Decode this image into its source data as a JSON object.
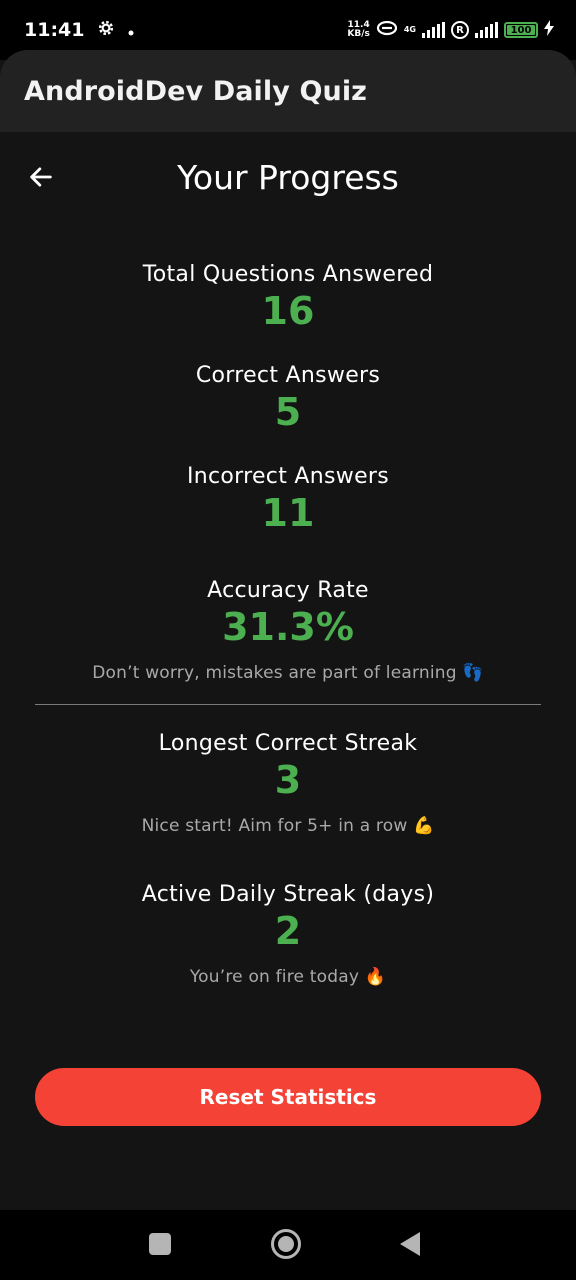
{
  "status_bar": {
    "time": "11:41",
    "speed_value": "11.4",
    "speed_unit": "KB/s",
    "network": "4G",
    "battery": "100"
  },
  "app_bar": {
    "title": "AndroidDev Daily Quiz"
  },
  "header": {
    "title": "Your Progress",
    "back_icon": "arrow-left-icon"
  },
  "stats": {
    "total": {
      "label": "Total Questions Answered",
      "value": "16"
    },
    "correct": {
      "label": "Correct Answers",
      "value": "5"
    },
    "incorrect": {
      "label": "Incorrect Answers",
      "value": "11"
    },
    "accuracy": {
      "label": "Accuracy Rate",
      "value": "31.3%",
      "note": "Don’t worry, mistakes are part of learning 👣"
    },
    "longest_streak": {
      "label": "Longest Correct Streak",
      "value": "3",
      "note": "Nice start! Aim for 5+ in a row 💪"
    },
    "daily_streak": {
      "label": "Active Daily Streak (days)",
      "value": "2",
      "note": "You’re on fire today 🔥"
    }
  },
  "actions": {
    "reset_label": "Reset Statistics"
  },
  "colors": {
    "accent": "#4caf50",
    "danger": "#f44336",
    "background": "#141414",
    "app_bar": "#222222"
  }
}
